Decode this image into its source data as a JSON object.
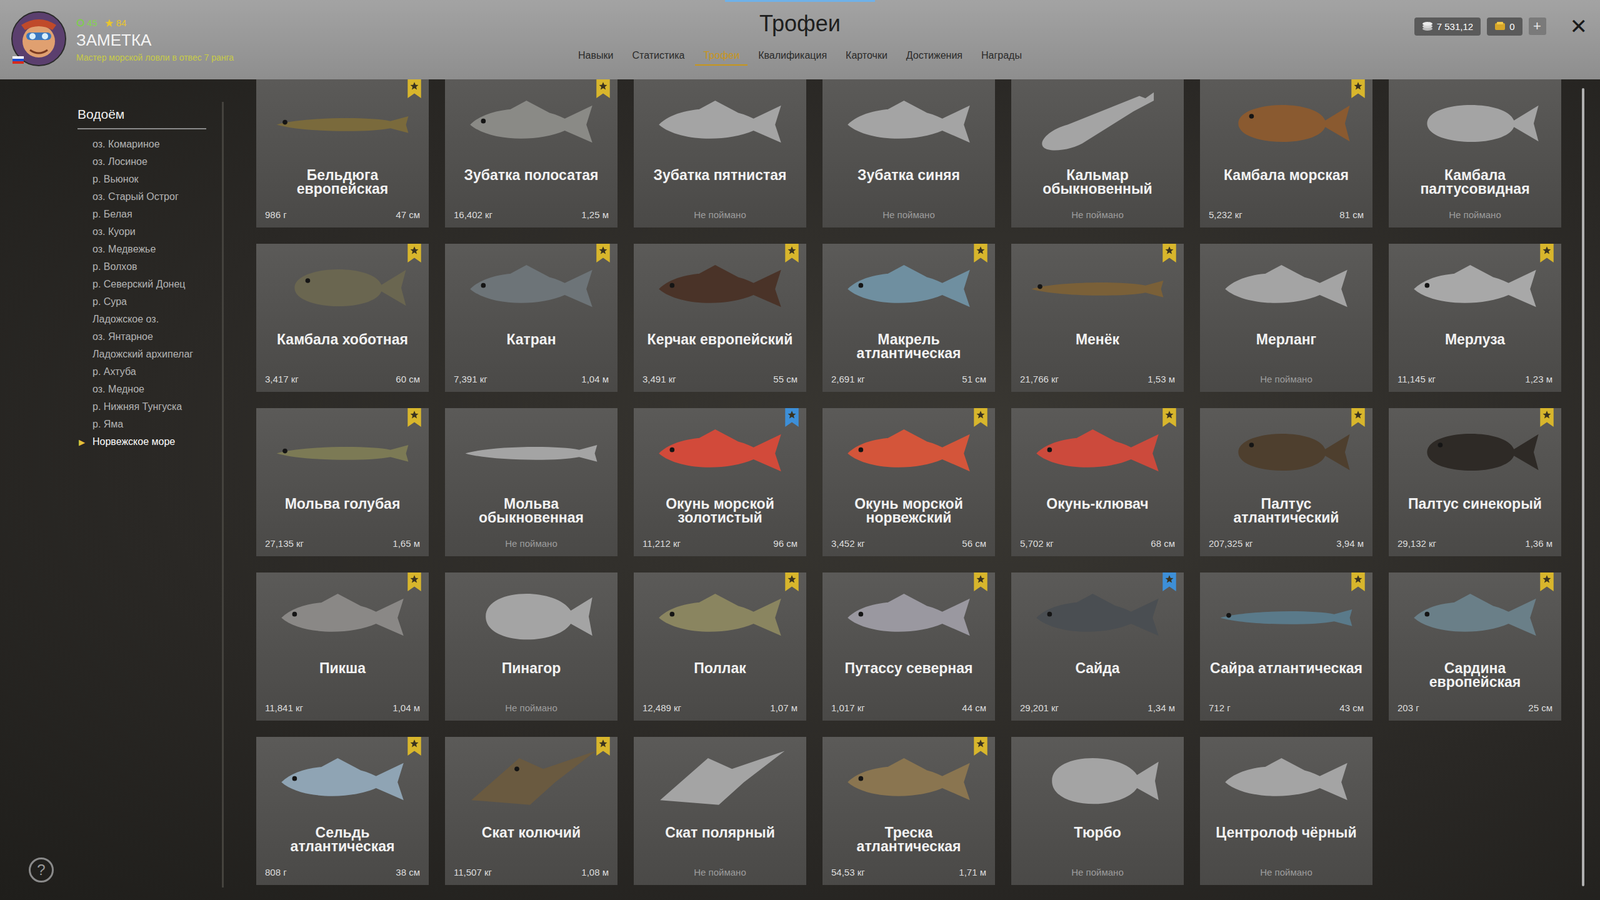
{
  "header": {
    "title": "Трофеи",
    "profile": {
      "name": "ЗАМЕТКА",
      "subtitle": "Мастер морской ловли в отвес 7 ранга",
      "level": "45",
      "rating": "84"
    },
    "tabs": [
      {
        "label": "Навыки",
        "selected": false
      },
      {
        "label": "Статистика",
        "selected": false
      },
      {
        "label": "Трофеи",
        "selected": true
      },
      {
        "label": "Квалификация",
        "selected": false
      },
      {
        "label": "Карточки",
        "selected": false
      },
      {
        "label": "Достижения",
        "selected": false
      },
      {
        "label": "Награды",
        "selected": false
      }
    ],
    "wallet": [
      {
        "value": "7 531,12",
        "kind": "silver"
      },
      {
        "value": "0",
        "kind": "gold"
      }
    ],
    "add_button": "+",
    "close_button": "✕"
  },
  "sidebar": {
    "title": "Водоём",
    "selected_marker": "▶",
    "items": [
      {
        "label": "оз. Комариное",
        "selected": false
      },
      {
        "label": "оз. Лосиное",
        "selected": false
      },
      {
        "label": "р. Вьюнок",
        "selected": false
      },
      {
        "label": "оз. Старый Острог",
        "selected": false
      },
      {
        "label": "р. Белая",
        "selected": false
      },
      {
        "label": "оз. Куори",
        "selected": false
      },
      {
        "label": "оз. Медвежье",
        "selected": false
      },
      {
        "label": "р. Волхов",
        "selected": false
      },
      {
        "label": "р. Северский Донец",
        "selected": false
      },
      {
        "label": "р. Сура",
        "selected": false
      },
      {
        "label": "Ладожское оз.",
        "selected": false
      },
      {
        "label": "оз. Янтарное",
        "selected": false
      },
      {
        "label": "Ладожский архипелаг",
        "selected": false
      },
      {
        "label": "р. Ахтуба",
        "selected": false
      },
      {
        "label": "оз. Медное",
        "selected": false
      },
      {
        "label": "р. Нижняя Тунгуска",
        "selected": false
      },
      {
        "label": "р. Яма",
        "selected": false
      },
      {
        "label": "Норвежское море",
        "selected": true
      }
    ]
  },
  "trophies": [
    {
      "name": "Бельдюга европейская",
      "caught": true,
      "weight": "986 г",
      "length": "47 см",
      "badge": "gold",
      "kind": "eel",
      "color": "#7a6a3c"
    },
    {
      "name": "Зубатка полосатая",
      "caught": true,
      "weight": "16,402 кг",
      "length": "1,25 м",
      "badge": "gold",
      "kind": "fish",
      "color": "#8a8a86"
    },
    {
      "name": "Зубатка пятнистая",
      "caught": false,
      "note": "Не поймано",
      "badge": "none",
      "kind": "fish"
    },
    {
      "name": "Зубатка синяя",
      "caught": false,
      "note": "Не поймано",
      "badge": "none",
      "kind": "fish"
    },
    {
      "name": "Кальмар обыкновенный",
      "caught": false,
      "note": "Не поймано",
      "badge": "none",
      "kind": "squid"
    },
    {
      "name": "Камбала морская",
      "caught": true,
      "weight": "5,232 кг",
      "length": "81 см",
      "badge": "gold",
      "kind": "flatfish",
      "color": "#8a5a30"
    },
    {
      "name": "Камбала палтусовидная",
      "caught": false,
      "note": "Не поймано",
      "badge": "none",
      "kind": "flatfish"
    },
    {
      "name": "Камбала хоботная",
      "caught": true,
      "weight": "3,417 кг",
      "length": "60 см",
      "badge": "gold",
      "kind": "flatfish",
      "color": "#6a6650"
    },
    {
      "name": "Катран",
      "caught": true,
      "weight": "7,391 кг",
      "length": "1,04 м",
      "badge": "gold",
      "kind": "fish",
      "color": "#6d7478"
    },
    {
      "name": "Керчак европейский",
      "caught": true,
      "weight": "3,491 кг",
      "length": "55 см",
      "badge": "gold",
      "kind": "fish",
      "color": "#4a3328"
    },
    {
      "name": "Макрель атлантическая",
      "caught": true,
      "weight": "2,691 кг",
      "length": "51 см",
      "badge": "gold",
      "kind": "fish",
      "color": "#6f8fa0"
    },
    {
      "name": "Менёк",
      "caught": true,
      "weight": "21,766 кг",
      "length": "1,53 м",
      "badge": "gold",
      "kind": "eel",
      "color": "#7a6038"
    },
    {
      "name": "Мерланг",
      "caught": false,
      "note": "Не поймано",
      "badge": "none",
      "kind": "fish"
    },
    {
      "name": "Мерлуза",
      "caught": true,
      "weight": "11,145 кг",
      "length": "1,23 м",
      "badge": "gold",
      "kind": "fish",
      "color": "#a8a8a8"
    },
    {
      "name": "Мольва голубая",
      "caught": true,
      "weight": "27,135 кг",
      "length": "1,65 м",
      "badge": "gold",
      "kind": "eel",
      "color": "#7c7a55"
    },
    {
      "name": "Мольва обыкновенная",
      "caught": false,
      "note": "Не поймано",
      "badge": "none",
      "kind": "eel"
    },
    {
      "name": "Окунь морской золотистый",
      "caught": true,
      "weight": "11,212 кг",
      "length": "96 см",
      "badge": "blue",
      "kind": "fish",
      "color": "#d24a3a"
    },
    {
      "name": "Окунь морской норвежский",
      "caught": true,
      "weight": "3,452 кг",
      "length": "56 см",
      "badge": "gold",
      "kind": "fish",
      "color": "#d4553a"
    },
    {
      "name": "Окунь-клювач",
      "caught": true,
      "weight": "5,702 кг",
      "length": "68 см",
      "badge": "gold",
      "kind": "fish",
      "color": "#cc4a3c"
    },
    {
      "name": "Палтус атлантический",
      "caught": true,
      "weight": "207,325 кг",
      "length": "3,94 м",
      "badge": "gold",
      "kind": "flatfish",
      "color": "#4e3f2e"
    },
    {
      "name": "Палтус синекорый",
      "caught": true,
      "weight": "29,132 кг",
      "length": "1,36 м",
      "badge": "gold",
      "kind": "flatfish",
      "color": "#2e2a26"
    },
    {
      "name": "Пикша",
      "caught": true,
      "weight": "11,841 кг",
      "length": "1,04 м",
      "badge": "gold",
      "kind": "fish",
      "color": "#8a8886"
    },
    {
      "name": "Пинагор",
      "caught": false,
      "note": "Не поймано",
      "badge": "none",
      "kind": "round"
    },
    {
      "name": "Поллак",
      "caught": true,
      "weight": "12,489 кг",
      "length": "1,07 м",
      "badge": "gold",
      "kind": "fish",
      "color": "#8a8560"
    },
    {
      "name": "Путассу северная",
      "caught": true,
      "weight": "1,017 кг",
      "length": "44 см",
      "badge": "gold",
      "kind": "fish",
      "color": "#9a98a0"
    },
    {
      "name": "Сайда",
      "caught": true,
      "weight": "29,201 кг",
      "length": "1,34 м",
      "badge": "blue",
      "kind": "fish",
      "color": "#4a4e52"
    },
    {
      "name": "Сайра атлантическая",
      "caught": true,
      "weight": "712 г",
      "length": "43 см",
      "badge": "gold",
      "kind": "eel",
      "color": "#5a7a8a"
    },
    {
      "name": "Сардина европейская",
      "caught": true,
      "weight": "203 г",
      "length": "25 см",
      "badge": "gold",
      "kind": "fish",
      "color": "#6a7f88"
    },
    {
      "name": "Сельдь атлантическая",
      "caught": true,
      "weight": "808 г",
      "length": "38 см",
      "badge": "gold",
      "kind": "fish",
      "color": "#8fa4b4"
    },
    {
      "name": "Скат колючий",
      "caught": true,
      "weight": "11,507 кг",
      "length": "1,08 м",
      "badge": "gold",
      "kind": "ray",
      "color": "#6a5a40"
    },
    {
      "name": "Скат полярный",
      "caught": false,
      "note": "Не поймано",
      "badge": "none",
      "kind": "ray"
    },
    {
      "name": "Треска атлантическая",
      "caught": true,
      "weight": "54,53 кг",
      "length": "1,71 м",
      "badge": "gold",
      "kind": "fish",
      "color": "#8a7550"
    },
    {
      "name": "Тюрбо",
      "caught": false,
      "note": "Не поймано",
      "badge": "none",
      "kind": "round"
    },
    {
      "name": "Центролоф чёрный",
      "caught": false,
      "note": "Не поймано",
      "badge": "none",
      "kind": "fish"
    }
  ],
  "help_button": "?"
}
